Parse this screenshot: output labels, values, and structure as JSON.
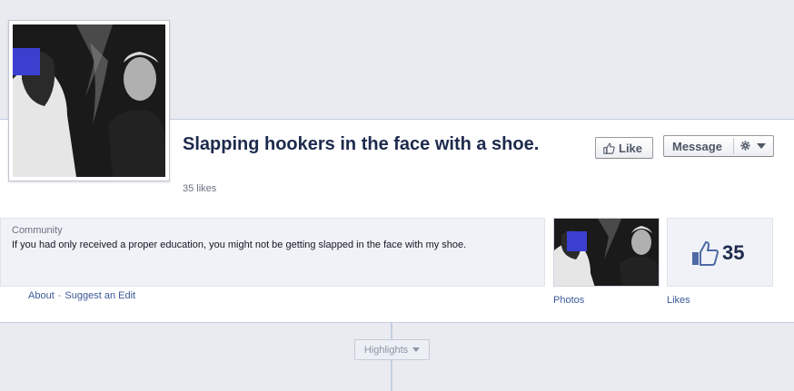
{
  "page": {
    "title": "Slapping hookers in the face with a shoe.",
    "likes_text": "35 likes"
  },
  "actions": {
    "like_label": "Like",
    "message_label": "Message"
  },
  "about": {
    "category": "Community",
    "description": "If you had only received a proper education, you might not be getting slapped in the face with my shoe.",
    "about_link": "About",
    "separator": "-",
    "suggest_edit_link": "Suggest an Edit"
  },
  "apps": {
    "photos_label": "Photos",
    "likes_label": "Likes",
    "likes_count": "35"
  },
  "timeline": {
    "highlights_label": "Highlights"
  },
  "colors": {
    "link": "#3b5998",
    "title": "#1d2a4d",
    "background": "#e9ebf0",
    "censor_block": "#3b3fd0"
  },
  "icons": [
    "thumbs-up-icon",
    "gear-icon",
    "chevron-down-icon"
  ]
}
